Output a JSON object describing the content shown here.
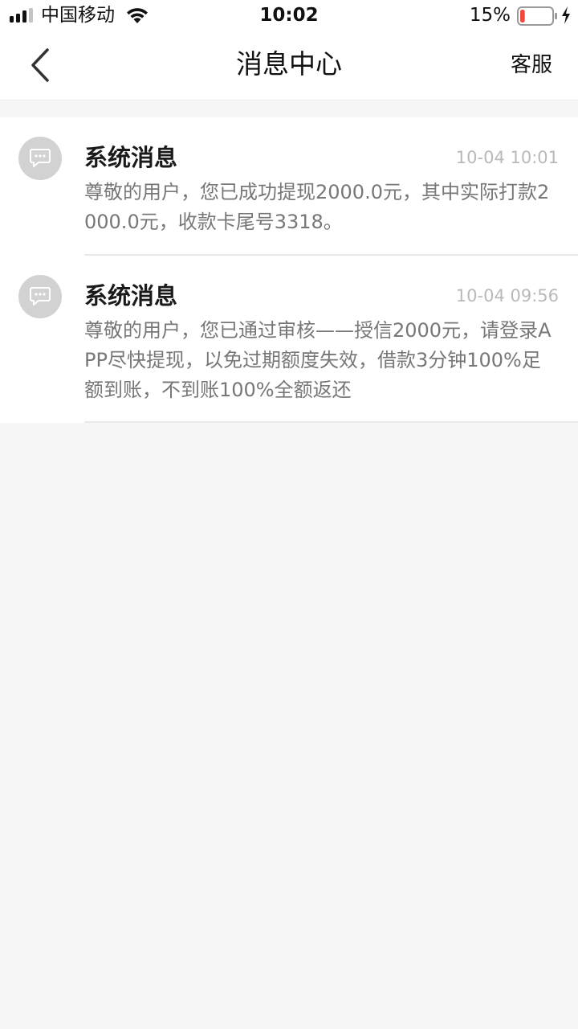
{
  "status_bar": {
    "carrier": "中国移动",
    "time": "10:02",
    "battery_percent": "15%",
    "battery_level": 0.15,
    "icons": [
      "signal-icon",
      "wifi-icon",
      "battery-icon",
      "charging-icon"
    ]
  },
  "nav": {
    "title": "消息中心",
    "action_label": "客服",
    "back_icon": "chevron-left-icon"
  },
  "messages": [
    {
      "title": "系统消息",
      "time": "10-04 10:01",
      "body": "尊敬的用户，您已成功提现2000.0元，其中实际打款2000.0元，收款卡尾号3318。",
      "icon": "message-bubble-icon"
    },
    {
      "title": "系统消息",
      "time": "10-04 09:56",
      "body": "尊敬的用户，您已通过审核——授信2000元，请登录APP尽快提现，以免过期额度失效，借款3分钟100%足额到账，不到账100%全额返还",
      "icon": "message-bubble-icon"
    }
  ],
  "colors": {
    "background": "#f6f6f6",
    "surface": "#ffffff",
    "icon_bg": "#d2d2d2",
    "body_text": "#777777",
    "time_text": "#b9b9b9",
    "battery_low": "#f04a3e"
  }
}
